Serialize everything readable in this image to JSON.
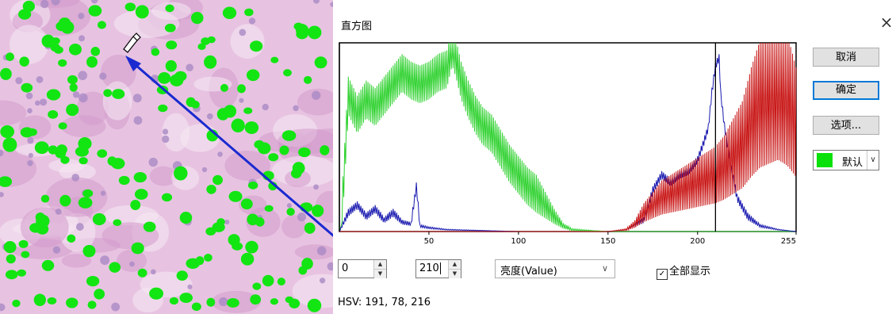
{
  "dialog": {
    "title": "直方图",
    "close_symbol": "×",
    "buttons": {
      "cancel": "取消",
      "ok": "确定",
      "options": "选项..."
    },
    "color_select": {
      "label": "默认",
      "swatch_color": "#0ae10a"
    },
    "low_value": "0",
    "high_value": "210",
    "mode": "亮度(Value)",
    "show_all": {
      "label": "全部显示",
      "checked": true
    },
    "hsv_readout": "HSV: 191, 78, 216"
  },
  "chart_data": {
    "type": "line",
    "x_range": [
      0,
      255
    ],
    "x_ticks": [
      "50",
      "100",
      "150",
      "200",
      "255"
    ],
    "x_tick_values": [
      50,
      100,
      150,
      200,
      255
    ],
    "threshold_markers": [
      0,
      210
    ],
    "series_colors": {
      "green": "#2fd12f",
      "blue": "#1a1ab0",
      "red": "#c81414"
    },
    "series": [
      {
        "color": "green",
        "x": [
          1,
          5,
          10,
          15,
          20,
          25,
          30,
          35,
          40,
          45,
          50,
          55,
          60,
          63,
          65,
          68,
          72,
          76,
          80,
          85,
          90,
          95,
          100,
          105,
          110,
          115,
          120,
          125,
          130,
          140,
          150,
          255
        ],
        "y": [
          2,
          72,
          62,
          70,
          66,
          72,
          78,
          84,
          80,
          78,
          80,
          84,
          86,
          98,
          92,
          80,
          70,
          62,
          56,
          52,
          44,
          36,
          30,
          24,
          20,
          14,
          8,
          3,
          1,
          0.5,
          0,
          0
        ]
      },
      {
        "color": "blue",
        "x": [
          0,
          5,
          10,
          15,
          20,
          25,
          30,
          35,
          40,
          43,
          45,
          50,
          60,
          100,
          150,
          160,
          170,
          175,
          180,
          185,
          190,
          195,
          200,
          203,
          206,
          208,
          210,
          212,
          213,
          215,
          218,
          222,
          228,
          235,
          245,
          255
        ],
        "y": [
          0,
          10,
          14,
          8,
          12,
          6,
          10,
          5,
          4,
          24,
          3,
          2,
          1,
          0,
          0,
          1,
          6,
          22,
          30,
          26,
          30,
          32,
          38,
          46,
          55,
          74,
          88,
          92,
          72,
          56,
          38,
          18,
          8,
          3,
          1,
          0
        ]
      },
      {
        "color": "red",
        "x": [
          0,
          150,
          160,
          165,
          170,
          175,
          180,
          185,
          190,
          195,
          200,
          205,
          210,
          215,
          220,
          225,
          230,
          235,
          240,
          245,
          250,
          255
        ],
        "y": [
          0,
          0,
          1,
          4,
          10,
          14,
          18,
          20,
          22,
          24,
          26,
          28,
          30,
          34,
          40,
          46,
          58,
          68,
          72,
          76,
          70,
          58
        ]
      }
    ]
  }
}
